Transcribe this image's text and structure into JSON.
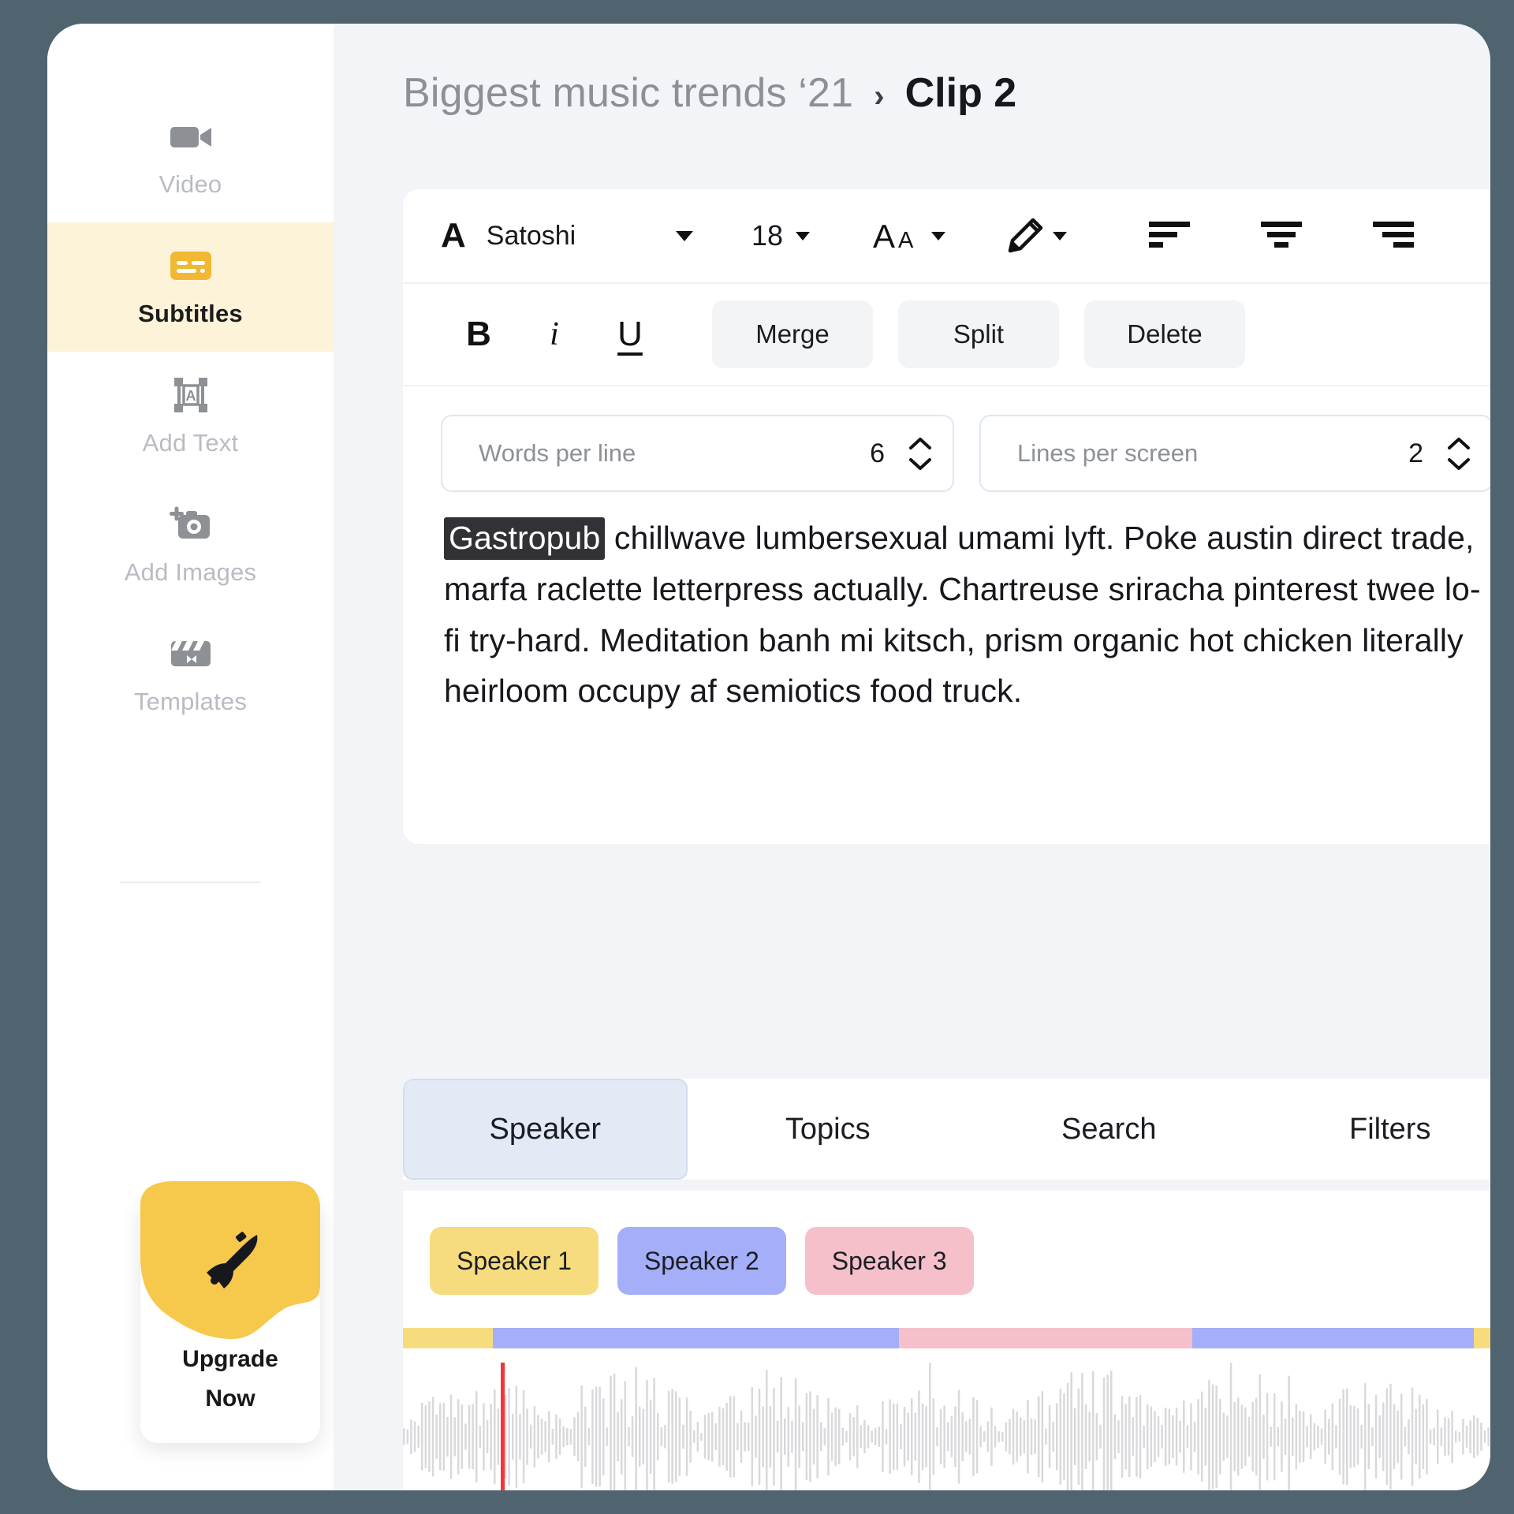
{
  "breadcrumb": {
    "parent": "Biggest music trends ‘21",
    "separator": "›",
    "current": "Clip 2"
  },
  "sidebar": {
    "items": [
      {
        "label": "Video",
        "icon": "video-camera-icon",
        "active": false
      },
      {
        "label": "Subtitles",
        "icon": "subtitles-icon",
        "active": true
      },
      {
        "label": "Add Text",
        "icon": "add-text-icon",
        "active": false
      },
      {
        "label": "Add Images",
        "icon": "add-image-icon",
        "active": false
      },
      {
        "label": "Templates",
        "icon": "clapperboard-icon",
        "active": false
      }
    ],
    "upgrade": {
      "line1": "Upgrade",
      "line2": "Now",
      "icon": "rocket-icon"
    }
  },
  "toolbar": {
    "font_icon": "A",
    "font_name": "Satoshi",
    "font_size": "18",
    "case_icon": "Aa",
    "color_icon": "pencil-icon",
    "align_left_icon": "align-left-icon",
    "align_center_icon": "align-center-icon",
    "align_right_icon": "align-right-icon"
  },
  "format": {
    "bold": "B",
    "italic": "i",
    "underline": "U",
    "merge": "Merge",
    "split": "Split",
    "delete": "Delete"
  },
  "steppers": [
    {
      "label": "Words per line",
      "value": "6"
    },
    {
      "label": "Lines per screen",
      "value": "2"
    }
  ],
  "subtitle": {
    "highlight": "Gastropub",
    "body": " chillwave lumbersexual umami lyft. Poke austin direct trade, marfa raclette letterpress actually. Chartreuse sriracha pinterest twee lo-fi try-hard. Meditation banh mi kitsch, prism organic hot chicken literally heirloom occupy af semiotics food truck."
  },
  "tabs": [
    {
      "label": "Speaker",
      "active": true
    },
    {
      "label": "Topics",
      "active": false
    },
    {
      "label": "Search",
      "active": false
    },
    {
      "label": "Filters",
      "active": false
    }
  ],
  "speakers": [
    {
      "label": "Speaker 1",
      "color": "#f6dc7f"
    },
    {
      "label": "Speaker 2",
      "color": "#a5aef8"
    },
    {
      "label": "Speaker 3",
      "color": "#f6c0cb"
    }
  ],
  "timeline": [
    {
      "speaker": "Speaker 1",
      "color": "#f6dc7f",
      "width_pct": 8
    },
    {
      "speaker": "Speaker 2",
      "color": "#a5aef8",
      "width_pct": 36
    },
    {
      "speaker": "Speaker 3",
      "color": "#f6c0cb",
      "width_pct": 26
    },
    {
      "speaker": "Speaker 2",
      "color": "#a5aef8",
      "width_pct": 25
    },
    {
      "speaker": "Speaker 1",
      "color": "#f6dc7f",
      "width_pct": 5
    }
  ],
  "colors": {
    "accent_yellow": "#f2b833",
    "active_nav_bg": "#fdf3d8",
    "scrollbar": "#6b63f0",
    "playhead": "#f4353a",
    "tab_active_bg": "#e3eaf6",
    "window_bg": "#f2f4f7",
    "desktop_bg": "#4f646e"
  }
}
